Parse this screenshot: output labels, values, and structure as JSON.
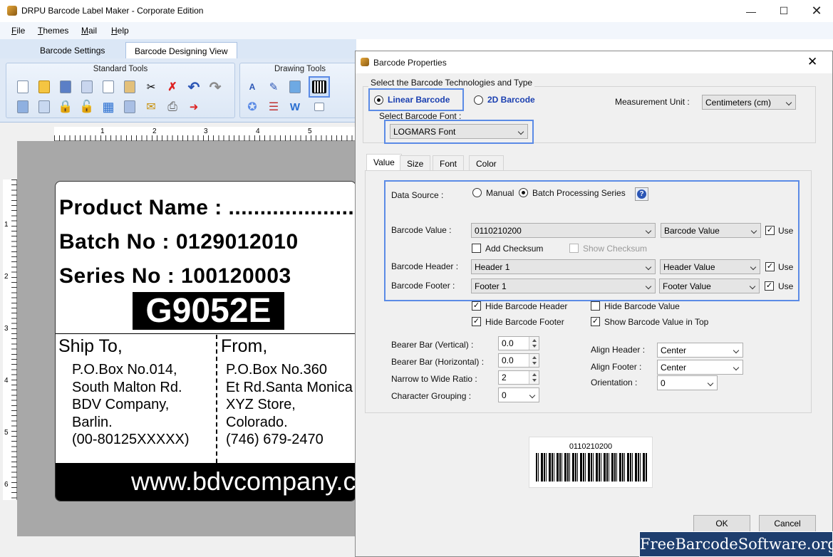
{
  "app": {
    "title": "DRPU Barcode Label Maker - Corporate Edition"
  },
  "menu": [
    "File",
    "Themes",
    "Mail",
    "Help"
  ],
  "tabs": {
    "settings": "Barcode Settings",
    "designing": "Barcode Designing View"
  },
  "ribbon": {
    "standard": "Standard Tools",
    "drawing": "Drawing Tools"
  },
  "ruler": {
    "h": [
      "1",
      "2",
      "3",
      "4",
      "5"
    ],
    "v": [
      "1",
      "2",
      "3",
      "4",
      "5",
      "6"
    ]
  },
  "label": {
    "product": "Product Name : .....................",
    "batch": "Batch No : 0129012010",
    "series": "Series No : 100120003",
    "code": "G9052E",
    "ship_title": "Ship To,",
    "ship_lines": [
      "P.O.Box No.014,",
      "South Malton Rd.",
      "BDV Company,",
      "Barlin.",
      "(00-80125XXXXX)"
    ],
    "from_title": "From,",
    "from_lines": [
      "P.O.Box No.360",
      "Et Rd.Santa Monica",
      "XYZ Store,",
      "Colorado.",
      "(746) 679-2470"
    ],
    "website": "www.bdvcompany.com"
  },
  "dialog": {
    "title": "Barcode Properties",
    "tech_group": "Select the Barcode Technologies and Type",
    "linear": "Linear Barcode",
    "twod": "2D Barcode",
    "measurement_label": "Measurement Unit :",
    "measurement_value": "Centimeters (cm)",
    "font_label": "Select Barcode Font :",
    "font_value": "LOGMARS Font",
    "tabs": [
      "Value",
      "Size",
      "Font",
      "Color"
    ],
    "data_source_label": "Data Source :",
    "manual": "Manual",
    "batch_series": "Batch Processing Series",
    "barcode_value_label": "Barcode Value :",
    "barcode_value": "0110210200",
    "barcode_value_type": "Barcode Value",
    "use": "Use",
    "add_checksum": "Add Checksum",
    "show_checksum": "Show Checksum",
    "header_label": "Barcode Header :",
    "header_value": "Header 1",
    "header_type": "Header Value",
    "footer_label": "Barcode Footer :",
    "footer_value": "Footer 1",
    "footer_type": "Footer Value",
    "hide_header": "Hide Barcode Header",
    "hide_footer": "Hide Barcode Footer",
    "hide_value": "Hide Barcode Value",
    "show_top": "Show Barcode Value in Top",
    "bearer_v_label": "Bearer Bar (Vertical) :",
    "bearer_v": "0.0",
    "bearer_h_label": "Bearer Bar (Horizontal) :",
    "bearer_h": "0.0",
    "ratio_label": "Narrow to Wide Ratio :",
    "ratio": "2",
    "grouping_label": "Character Grouping :",
    "grouping": "0",
    "align_header_label": "Align Header :",
    "align_header": "Center",
    "align_footer_label": "Align Footer :",
    "align_footer": "Center",
    "orientation_label": "Orientation :",
    "orientation": "0",
    "preview_value": "0110210200",
    "ok": "OK",
    "cancel": "Cancel"
  },
  "watermark": "FreeBarcodeSoftware.org",
  "colors": {
    "highlight": "#5b8be6",
    "watermark_bg": "#1e3e6e",
    "ribbon_bg": "#dfe9f6"
  }
}
